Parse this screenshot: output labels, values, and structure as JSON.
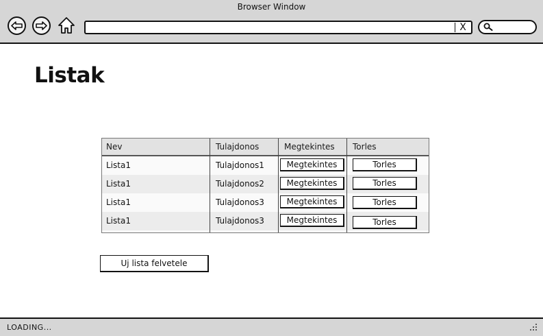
{
  "window": {
    "title": "Browser Window"
  },
  "address": {
    "value": "",
    "clear_label": "X"
  },
  "search": {
    "value": ""
  },
  "page": {
    "title": "Listak"
  },
  "table": {
    "headers": [
      "Nev",
      "Tulajdonos",
      "Megtekintes",
      "Torles"
    ],
    "rows": [
      {
        "name": "Lista1",
        "owner": "Tulajdonos1",
        "view_label": "Megtekintes",
        "delete_label": "Torles"
      },
      {
        "name": "Lista1",
        "owner": "Tulajdonos2",
        "view_label": "Megtekintes",
        "delete_label": "Torles"
      },
      {
        "name": "Lista1",
        "owner": "Tulajdonos3",
        "view_label": "Megtekintes",
        "delete_label": "Torles"
      },
      {
        "name": "Lista1",
        "owner": "Tulajdonos3",
        "view_label": "Megtekintes",
        "delete_label": "Torles"
      }
    ]
  },
  "actions": {
    "new_list_label": "Uj lista felvetele"
  },
  "status": {
    "text": "LOADING..."
  },
  "icons": {
    "back": "back-arrow-icon",
    "forward": "forward-arrow-icon",
    "home": "home-icon",
    "search": "search-icon",
    "resize": "resize-grip-icon"
  }
}
